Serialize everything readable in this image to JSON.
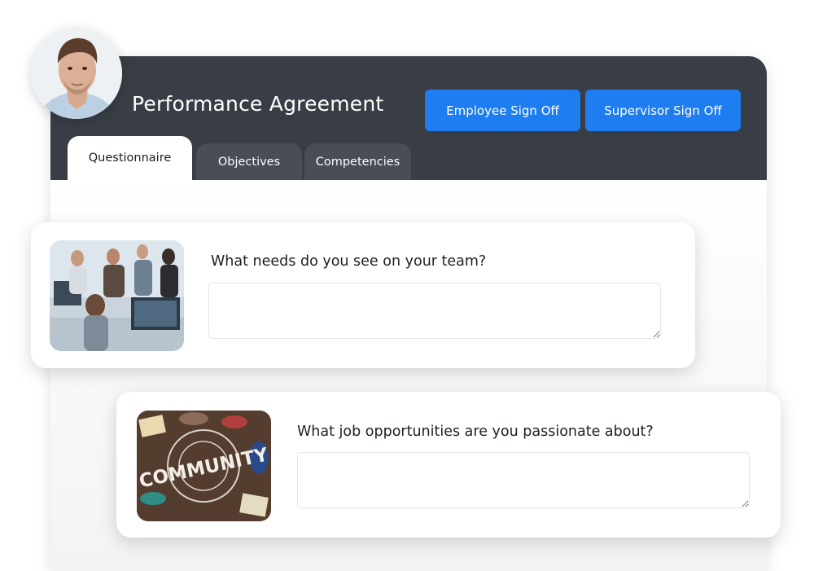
{
  "header": {
    "title": "Performance Agreement",
    "employee_signoff_label": "Employee Sign Off",
    "supervisor_signoff_label": "Supervisor Sign Off"
  },
  "tabs": [
    {
      "label": "Questionnaire",
      "active": true
    },
    {
      "label": "Objectives",
      "active": false
    },
    {
      "label": "Competencies",
      "active": false
    }
  ],
  "questions": [
    {
      "text": "What needs do you see on your team?",
      "answer_value": ""
    },
    {
      "text": "What job opportunities are you passionate about?",
      "answer_value": ""
    }
  ],
  "images": {
    "community_text": "COMMUNITY"
  },
  "colors": {
    "header_bg": "#393d45",
    "tab_inactive_bg": "#484d56",
    "button_accent": "#1e7df0"
  }
}
